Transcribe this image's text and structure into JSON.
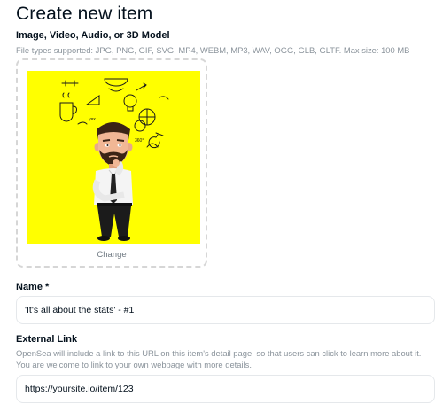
{
  "page": {
    "title": "Create new item"
  },
  "media": {
    "label": "Image, Video, Audio, or 3D Model",
    "file_types": "File types supported: JPG, PNG, GIF, SVG, MP4, WEBM, MP3, WAV, OGG, GLB, GLTF. Max size: 100 MB",
    "change_label": "Change",
    "preview_background": "#ffff00",
    "preview_doodles": [
      "y=x",
      "360°"
    ]
  },
  "name_field": {
    "label": "Name *",
    "value": "'It's all about the stats' - #1"
  },
  "external_link": {
    "label": "External Link",
    "help_line1": "OpenSea will include a link to this URL on this item's detail page, so that users can click to learn more about it.",
    "help_line2": "You are welcome to link to your own webpage with more details.",
    "value": "https://yoursite.io/item/123"
  }
}
